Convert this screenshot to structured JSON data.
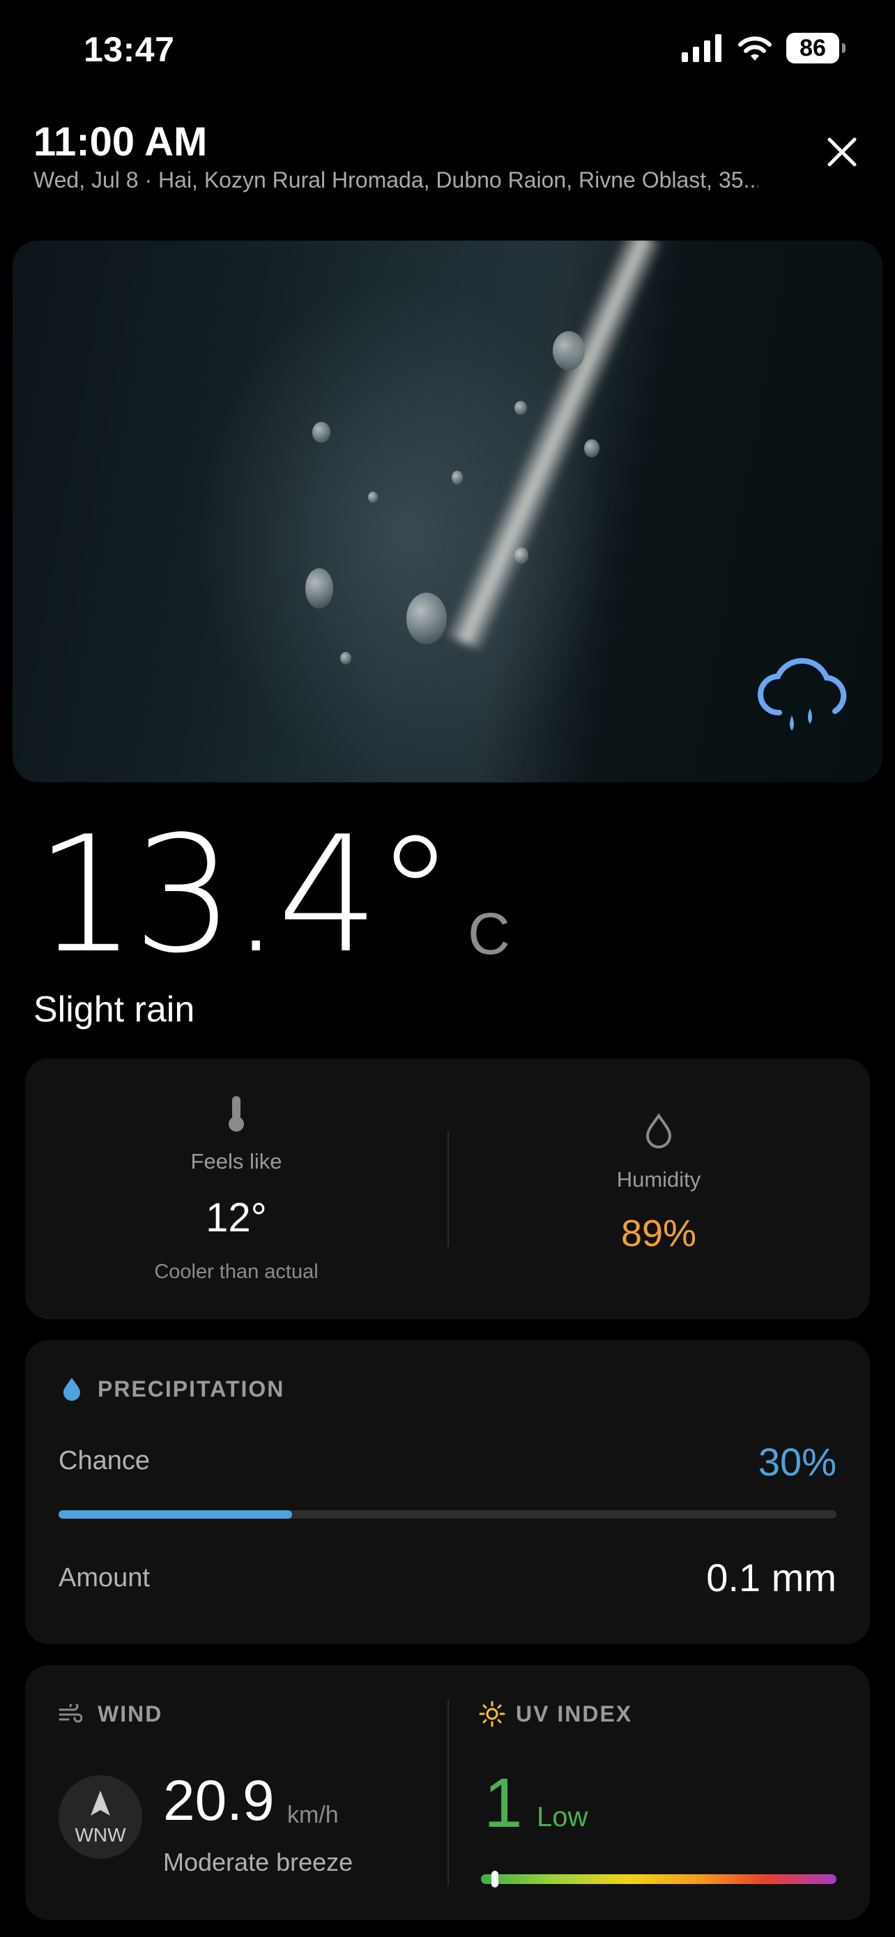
{
  "status_bar": {
    "time": "13:47",
    "battery": "86"
  },
  "header": {
    "time": "11:00 AM",
    "subtitle": "Wed, Jul 8 · Hai, Kozyn Rural Hromada, Dubno Raion, Rivne Oblast, 35..."
  },
  "hero": {
    "icon": "rain-cloud-icon"
  },
  "current": {
    "temperature": "13.4°",
    "unit": "C",
    "condition": "Slight rain"
  },
  "feels_like": {
    "label": "Feels like",
    "value": "12°",
    "note": "Cooler than actual"
  },
  "humidity": {
    "label": "Humidity",
    "value": "89%",
    "color": "#f0a039"
  },
  "precipitation": {
    "title": "PRECIPITATION",
    "chance_label": "Chance",
    "chance_value": "30%",
    "chance_fraction": 0.3,
    "amount_label": "Amount",
    "amount_value": "0.1 mm",
    "accent_color": "#4ea3df"
  },
  "wind": {
    "title": "WIND",
    "direction": "WNW",
    "speed": "20.9",
    "unit": "km/h",
    "description": "Moderate breeze"
  },
  "uv_index": {
    "title": "UV INDEX",
    "value": "1",
    "level": "Low",
    "scale_fraction": 0.04,
    "color": "#4caf50"
  }
}
